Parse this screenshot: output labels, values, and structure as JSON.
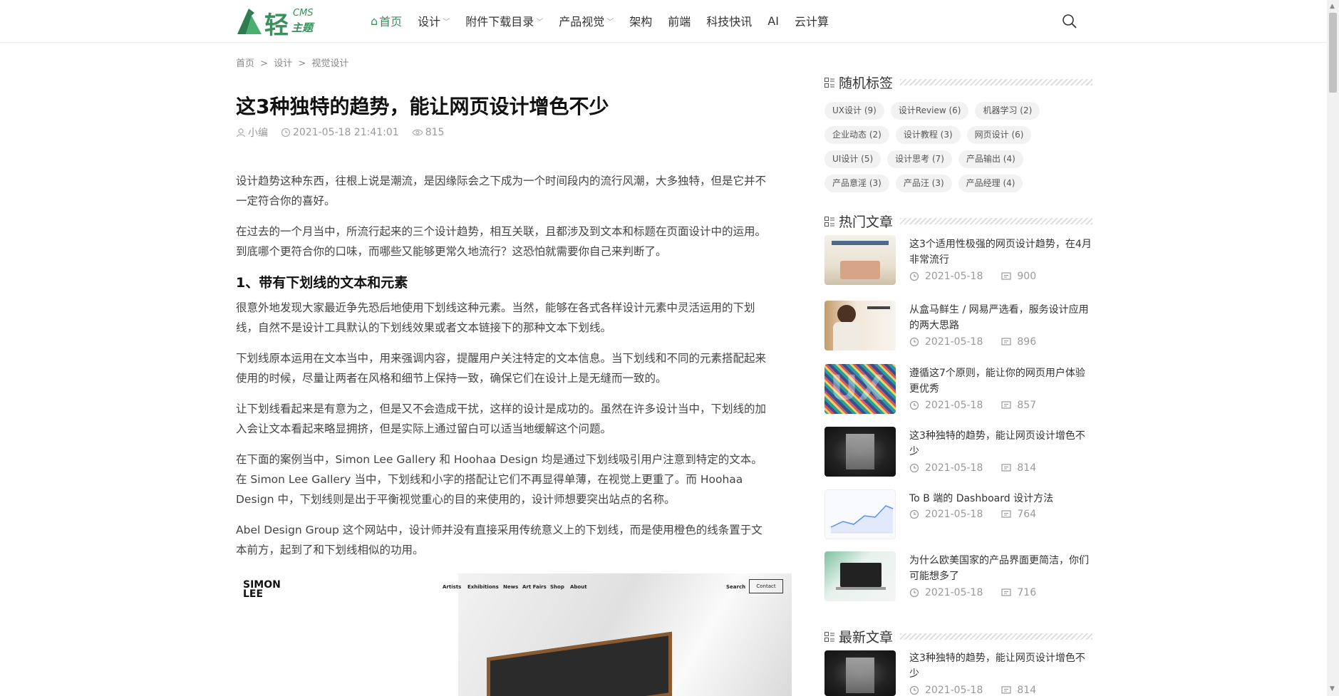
{
  "header": {
    "logo": {
      "main": "轻",
      "cms": "CMS",
      "sub": "主题"
    },
    "nav": [
      {
        "label": "首页",
        "active": true,
        "dropdown": false
      },
      {
        "label": "设计",
        "active": false,
        "dropdown": true
      },
      {
        "label": "附件下载目录",
        "active": false,
        "dropdown": true
      },
      {
        "label": "产品视觉",
        "active": false,
        "dropdown": true
      },
      {
        "label": "架构",
        "active": false,
        "dropdown": false
      },
      {
        "label": "前端",
        "active": false,
        "dropdown": false
      },
      {
        "label": "科技快讯",
        "active": false,
        "dropdown": false
      },
      {
        "label": "AI",
        "active": false,
        "dropdown": false
      },
      {
        "label": "云计算",
        "active": false,
        "dropdown": false
      }
    ],
    "search_icon": "search-icon"
  },
  "breadcrumb": [
    "首页",
    ">",
    "设计",
    ">",
    "视觉设计"
  ],
  "article": {
    "title": "这3种独特的趋势，能让网页设计增色不少",
    "author": "小编",
    "datetime": "2021-05-18 21:41:01",
    "views": "815",
    "paragraphs": [
      "设计趋势这种东西，往根上说是潮流，是因缘际会之下成为一个时间段内的流行风潮，大多独特，但是它并不一定符合你的喜好。",
      "在过去的一个月当中，所流行起来的三个设计趋势，相互关联，且都涉及到文本和标题在页面设计中的运用。到底哪个更符合你的口味，而哪些又能够更常久地流行？这恐怕就需要你自己来判断了。"
    ],
    "heading1": "1、带有下划线的文本和元素",
    "paragraphs2": [
      "很意外地发现大家最近争先恐后地使用下划线这种元素。当然，能够在各式各样设计元素中灵活运用的下划线，自然不是设计工具默认的下划线效果或者文本链接下的那种文本下划线。",
      "下划线原本运用在文本当中，用来强调内容，提醒用户关注特定的文本信息。当下划线和不同的元素搭配起来使用的时候，尽量让两者在风格和细节上保持一致，确保它们在设计上是无缝而一致的。",
      "让下划线看起来是有意为之，但是又不会造成干扰，这样的设计是成功的。虽然在许多设计当中，下划线的加入会让文本看起来略显拥挤，但是实际上通过留白可以适当地缓解这个问题。",
      "在下面的案例当中，Simon Lee Gallery 和 Hoohaa Design 均是通过下划线吸引用户注意到特定的文本。在 Simon Lee Gallery 当中，下划线和小字的搭配让它们不再显得单薄，在视觉上更重了。而 Hoohaa Design 中，下划线则是出于平衡视觉重心的目的来使用的，设计师想要突出站点的名称。",
      "Abel Design Group 这个网站中，设计师并没有直接采用传统意义上的下划线，而是使用橙色的线条置于文本前方，起到了和下划线相似的功用。"
    ],
    "image": {
      "logo": "SIMON LEE",
      "nav": [
        "Artists",
        "Exhibitions",
        "News",
        "Art Fairs",
        "Shop",
        "About"
      ],
      "search": "Search",
      "contact": "Contact"
    }
  },
  "sidebar": {
    "tags_title": "随机标签",
    "tags": [
      [
        "UX设计 (9)",
        "设计Review (6)",
        "机器学习 (2)"
      ],
      [
        "企业动态 (2)",
        "设计教程 (3)",
        "网页设计 (6)"
      ],
      [
        "UI设计 (5)",
        "设计思考 (7)",
        "产品输出 (4)"
      ],
      [
        "产品意淫 (3)",
        "产品汪 (3)",
        "产品经理 (4)"
      ]
    ],
    "hot_title": "热门文章",
    "hot": [
      {
        "title": "这3个适用性极强的网页设计趋势，在4月非常流行",
        "date": "2021-05-18",
        "comments": "900"
      },
      {
        "title": "从盒马鲜生 / 网易严选看，服务设计应用的两大思路",
        "date": "2021-05-18",
        "comments": "896"
      },
      {
        "title": "遵循这7个原则，能让你的网页用户体验更优秀",
        "date": "2021-05-18",
        "comments": "857"
      },
      {
        "title": "这3种独特的趋势，能让网页设计增色不少",
        "date": "2021-05-18",
        "comments": "814"
      },
      {
        "title": "To B 端的 Dashboard 设计方法",
        "date": "2021-05-18",
        "comments": "764"
      },
      {
        "title": "为什么欧美国家的产品界面更简洁，你们可能想多了",
        "date": "2021-05-18",
        "comments": "716"
      }
    ],
    "latest_title": "最新文章",
    "latest": [
      {
        "title": "这3种独特的趋势，能让网页设计增色不少",
        "date": "2021-05-18",
        "comments": "814"
      }
    ]
  },
  "colors": {
    "accent": "#3a8f5c",
    "text": "#333333",
    "muted": "#999999"
  }
}
